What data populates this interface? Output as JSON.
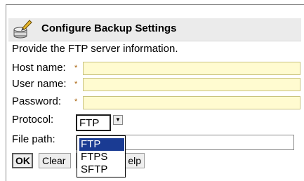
{
  "header": {
    "title": "Configure Backup Settings",
    "icon": "backup-settings-icon"
  },
  "intro_text": "Provide the FTP server information.",
  "form": {
    "host_label": "Host name:",
    "user_label": "User name:",
    "password_label": "Password:",
    "protocol_label": "Protocol:",
    "filepath_label": "File path:",
    "required_marker": "*",
    "host_value": "",
    "user_value": "",
    "password_value": "",
    "filepath_value": ""
  },
  "protocol": {
    "selected": "FTP",
    "options": [
      "FTP",
      "FTPS",
      "SFTP"
    ]
  },
  "buttons": {
    "ok": "OK",
    "clear": "Clear",
    "help_partial": "elp"
  },
  "colors": {
    "required_field_bg": "#fffbd0",
    "selected_option_bg": "#1a3b93"
  }
}
